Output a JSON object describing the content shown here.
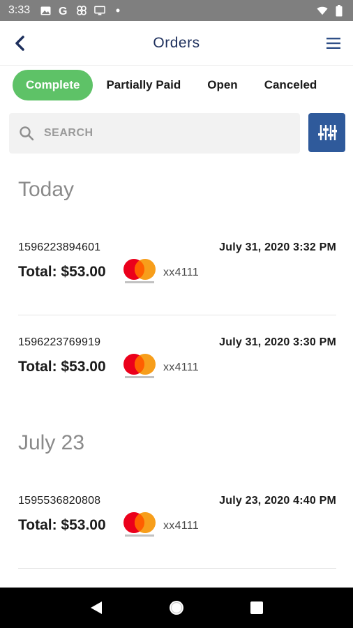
{
  "status_bar": {
    "time": "3:33",
    "icons": [
      "image-icon",
      "google-icon",
      "pinwheel-icon",
      "cast-icon",
      "dot-icon",
      "wifi-icon",
      "battery-icon"
    ]
  },
  "app_bar": {
    "title": "Orders",
    "back_icon": "chevron-left-icon",
    "menu_icon": "hamburger-menu-icon"
  },
  "tabs": [
    {
      "label": "Complete",
      "active": true
    },
    {
      "label": "Partially Paid",
      "active": false
    },
    {
      "label": "Open",
      "active": false
    },
    {
      "label": "Canceled",
      "active": false
    }
  ],
  "search": {
    "placeholder": "SEARCH",
    "filter_icon": "sliders-icon"
  },
  "sections": [
    {
      "title": "Today",
      "orders": [
        {
          "id": "1596223894601",
          "date": "July 31, 2020 3:32 PM",
          "total": "Total: $53.00",
          "card_brand": "mastercard",
          "card_last4": "xx4111"
        },
        {
          "id": "1596223769919",
          "date": "July 31, 2020 3:30 PM",
          "total": "Total: $53.00",
          "card_brand": "mastercard",
          "card_last4": "xx4111"
        }
      ]
    },
    {
      "title": "July 23",
      "orders": [
        {
          "id": "1595536820808",
          "date": "July 23, 2020 4:40 PM",
          "total": "Total: $53.00",
          "card_brand": "mastercard",
          "card_last4": "xx4111"
        }
      ]
    }
  ],
  "nav_bar": {
    "icons": [
      "back-triangle-icon",
      "home-circle-icon",
      "recents-square-icon"
    ]
  },
  "colors": {
    "accent_green": "#5ec267",
    "primary_blue": "#2f5a9b",
    "title_navy": "#1d2f5c",
    "mastercard_red": "#eb001b",
    "mastercard_orange": "#f79e1b"
  }
}
